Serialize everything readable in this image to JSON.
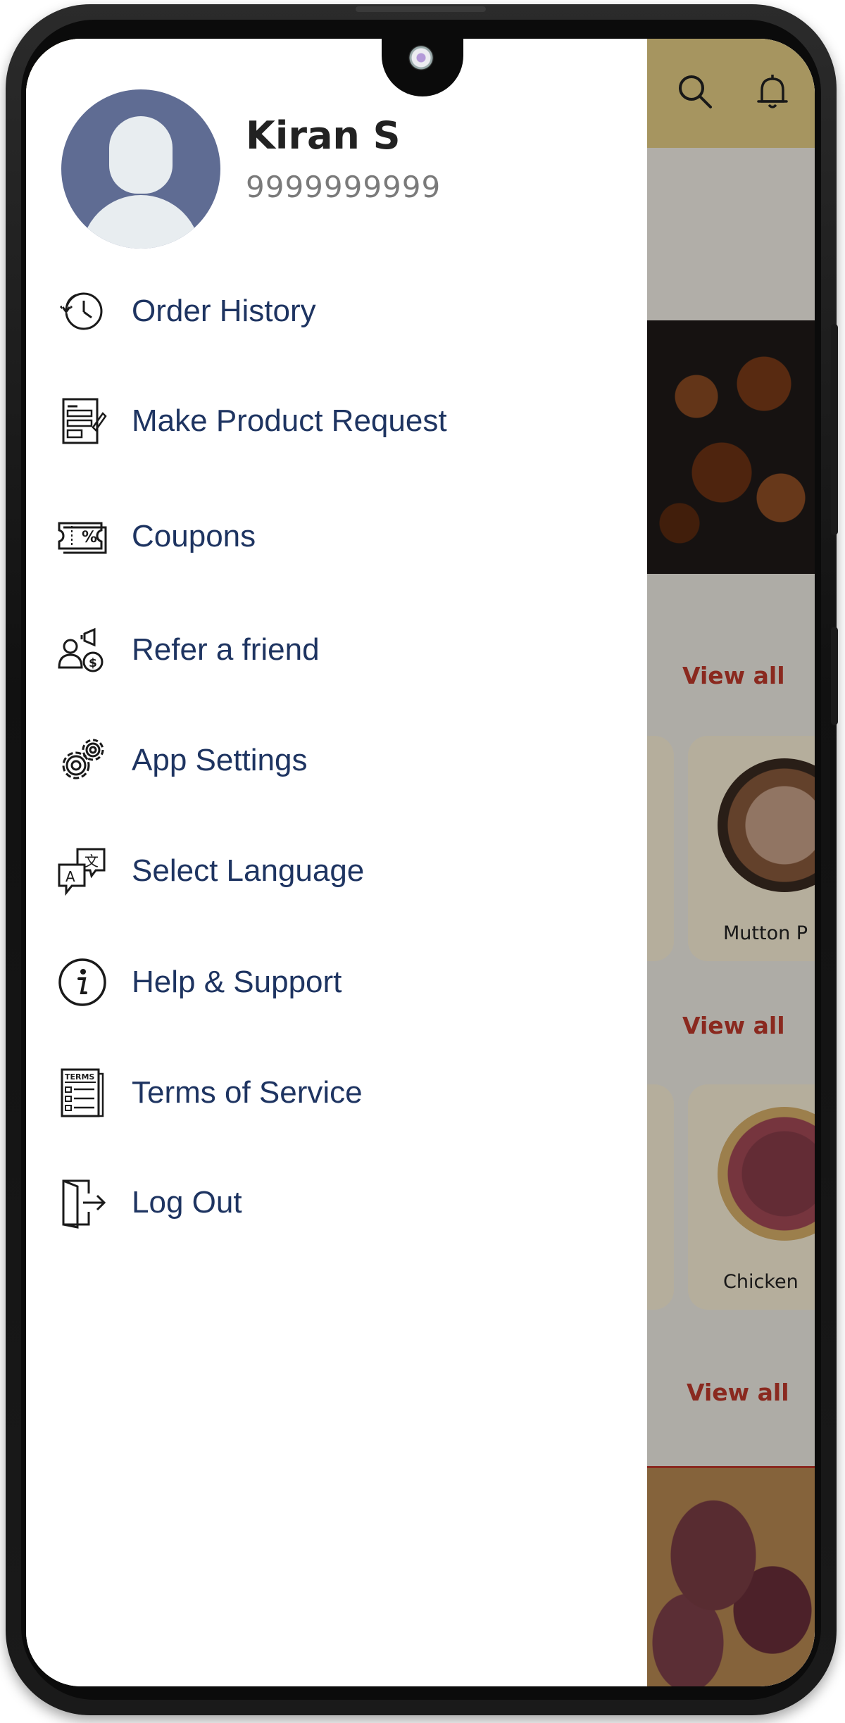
{
  "user": {
    "name": "Kiran S",
    "phone": "9999999999",
    "avatar_icon": "user-avatar-icon"
  },
  "menu": {
    "items": [
      {
        "label": "Order History",
        "icon": "history-icon"
      },
      {
        "label": "Make Product Request",
        "icon": "request-form-icon"
      },
      {
        "label": "Coupons",
        "icon": "coupon-icon"
      },
      {
        "label": "Refer a friend",
        "icon": "refer-icon"
      },
      {
        "label": "App Settings",
        "icon": "gear-icon"
      },
      {
        "label": "Select Language",
        "icon": "language-icon"
      },
      {
        "label": "Help & Support",
        "icon": "info-icon"
      },
      {
        "label": "Terms of Service",
        "icon": "terms-icon"
      },
      {
        "label": "Log Out",
        "icon": "logout-icon"
      }
    ]
  },
  "background": {
    "view_all_labels": [
      "View all",
      "View all",
      "View all"
    ],
    "card_labels": [
      "Mutton P",
      "Chicken"
    ],
    "header_icons": [
      "search-icon",
      "bell-icon"
    ]
  },
  "colors": {
    "menu_text": "#1e3461",
    "header": "#e6cf86",
    "view_all": "#c0392b",
    "avatar_bg": "#5f6c93"
  }
}
